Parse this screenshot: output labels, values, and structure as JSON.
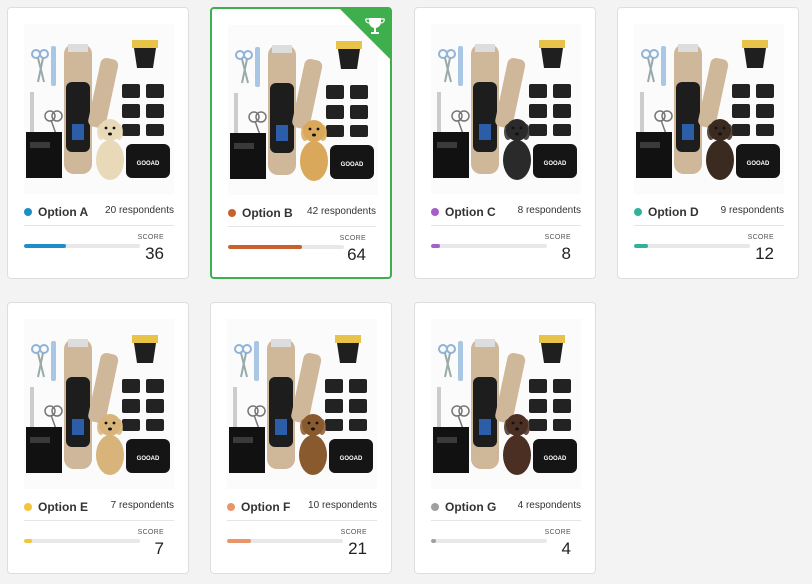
{
  "score_label": "SCORE",
  "brand": "GOOAD",
  "cards": [
    {
      "name": "Option A",
      "respondents": "20 respondents",
      "score": "36",
      "color": "#1e8ec8",
      "fill_pct": 36,
      "dog_color": "#e8d9b8",
      "winner": false
    },
    {
      "name": "Option B",
      "respondents": "42 respondents",
      "score": "64",
      "color": "#c8612d",
      "fill_pct": 64,
      "dog_color": "#d9a85a",
      "winner": true
    },
    {
      "name": "Option C",
      "respondents": "8 respondents",
      "score": "8",
      "color": "#a65fc7",
      "fill_pct": 8,
      "dog_color": "#2a2a2a",
      "winner": false
    },
    {
      "name": "Option D",
      "respondents": "9 respondents",
      "score": "12",
      "color": "#2db39a",
      "fill_pct": 12,
      "dog_color": "#3a2a20",
      "winner": false
    },
    {
      "name": "Option E",
      "respondents": "7 respondents",
      "score": "7",
      "color": "#f2c53a",
      "fill_pct": 7,
      "dog_color": "#d8b37a",
      "winner": false
    },
    {
      "name": "Option F",
      "respondents": "10 respondents",
      "score": "21",
      "color": "#e8956a",
      "fill_pct": 21,
      "dog_color": "#8a5a2f",
      "winner": false
    },
    {
      "name": "Option G",
      "respondents": "4 respondents",
      "score": "4",
      "color": "#a0a0a0",
      "fill_pct": 4,
      "dog_color": "#4a2f22",
      "winner": false
    }
  ]
}
